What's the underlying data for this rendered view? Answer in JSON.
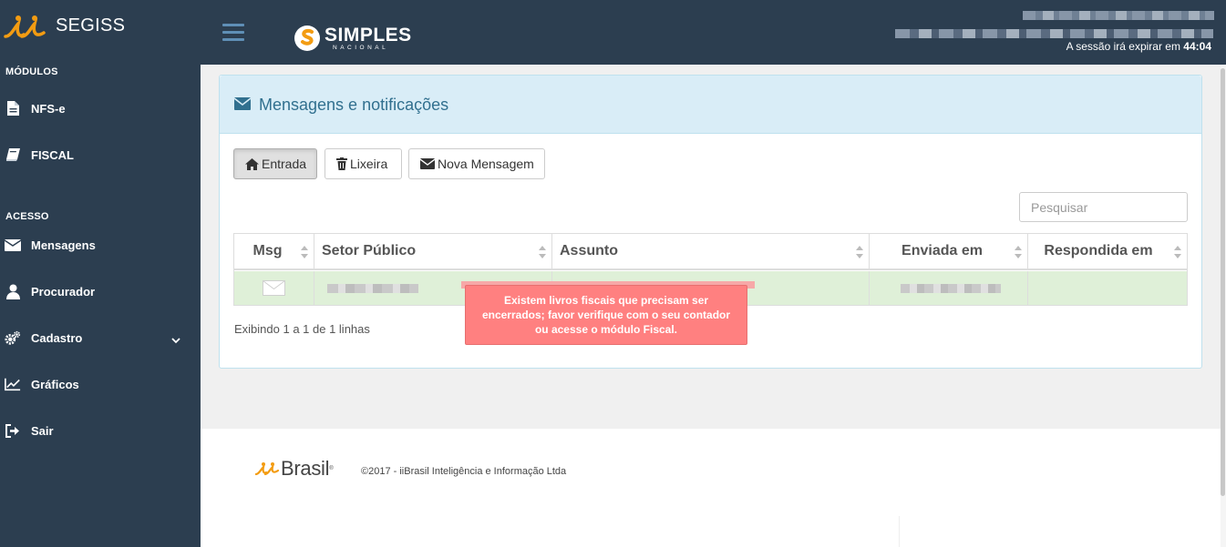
{
  "brand": {
    "name": "SEGISS",
    "accent_color": "#f39c12"
  },
  "sidebar": {
    "sections": [
      {
        "title": "MÓDULOS"
      },
      {
        "title": "ACESSO"
      }
    ],
    "items": [
      {
        "label": "NFS-e",
        "icon": "file-icon"
      },
      {
        "label": "FISCAL",
        "icon": "book-icon"
      },
      {
        "label": "Mensagens",
        "icon": "envelope-icon"
      },
      {
        "label": "Procurador",
        "icon": "user-icon"
      },
      {
        "label": "Cadastro",
        "icon": "cogs-icon"
      },
      {
        "label": "Gráficos",
        "icon": "chart-line-icon"
      },
      {
        "label": "Sair",
        "icon": "sign-out-icon"
      }
    ],
    "bg_color": "#2c3e50"
  },
  "header": {
    "logo_text": "SIMPLES",
    "logo_subtext": "NACIONAL",
    "session_prefix": "A sessão irá expirar em",
    "session_time": "44:04"
  },
  "panel": {
    "title": "Mensagens e notificações",
    "buttons": [
      {
        "label": "Entrada",
        "icon": "home-icon",
        "active": true
      },
      {
        "label": "Lixeira",
        "icon": "trash-icon",
        "active": false
      },
      {
        "label": "Nova Mensagem",
        "icon": "envelope-icon",
        "active": false
      }
    ],
    "search_placeholder": "Pesquisar",
    "table": {
      "columns": [
        "Msg",
        "Setor Público",
        "Assunto",
        "Enviada em",
        "Respondida em"
      ]
    },
    "count_text": "Exibindo 1 a 1 de 1 linhas"
  },
  "tooltip": {
    "line1": "Existem livros fiscais que precisam ser",
    "line2": "encerrados; favor verifique com o seu contador",
    "line3": "ou acesse o módulo Fiscal."
  },
  "footer": {
    "brand_word": "Brasil",
    "brand_mark": "®",
    "copyright": "©2017 - iiBrasil Inteligência e Informação Ltda"
  }
}
